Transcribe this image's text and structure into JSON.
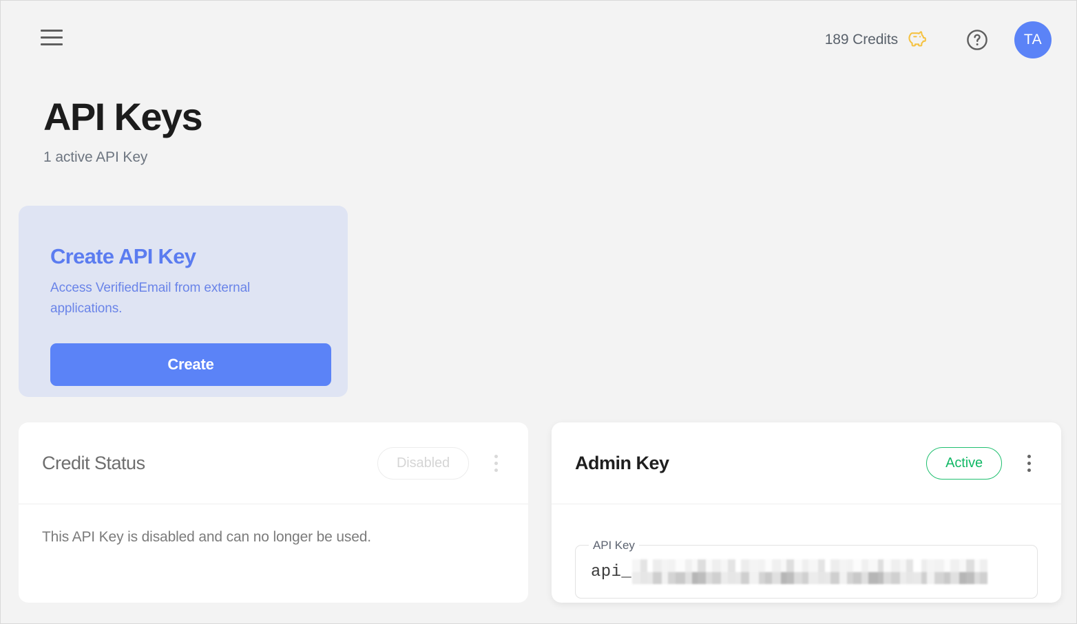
{
  "topbar": {
    "menu_icon": "hamburger-icon",
    "credits_label": "189 Credits",
    "credits_icon": "piggy-bank-icon",
    "credits_icon_color": "#f5c242",
    "help_icon": "question-circle-icon",
    "avatar_initials": "TA",
    "avatar_color": "#5b83f7"
  },
  "header": {
    "title": "API Keys",
    "subtitle": "1 active API Key"
  },
  "create_card": {
    "title": "Create API Key",
    "description": "Access VerifiedEmail from external applications.",
    "button_label": "Create",
    "background": "#dfe4f3",
    "accent": "#5b83f7"
  },
  "cards": [
    {
      "title": "Credit Status",
      "status_label": "Disabled",
      "status_color": "#d5d5d5",
      "menu_icon": "kebab-menu-icon",
      "body_text": "This API Key is disabled and can no longer be used.",
      "has_field": false
    },
    {
      "title": "Admin Key",
      "status_label": "Active",
      "status_color": "#12b866",
      "menu_icon": "kebab-menu-icon",
      "body_text": "",
      "has_field": true,
      "field_label": "API Key",
      "field_prefix": "api_",
      "field_value_redacted": true
    }
  ]
}
